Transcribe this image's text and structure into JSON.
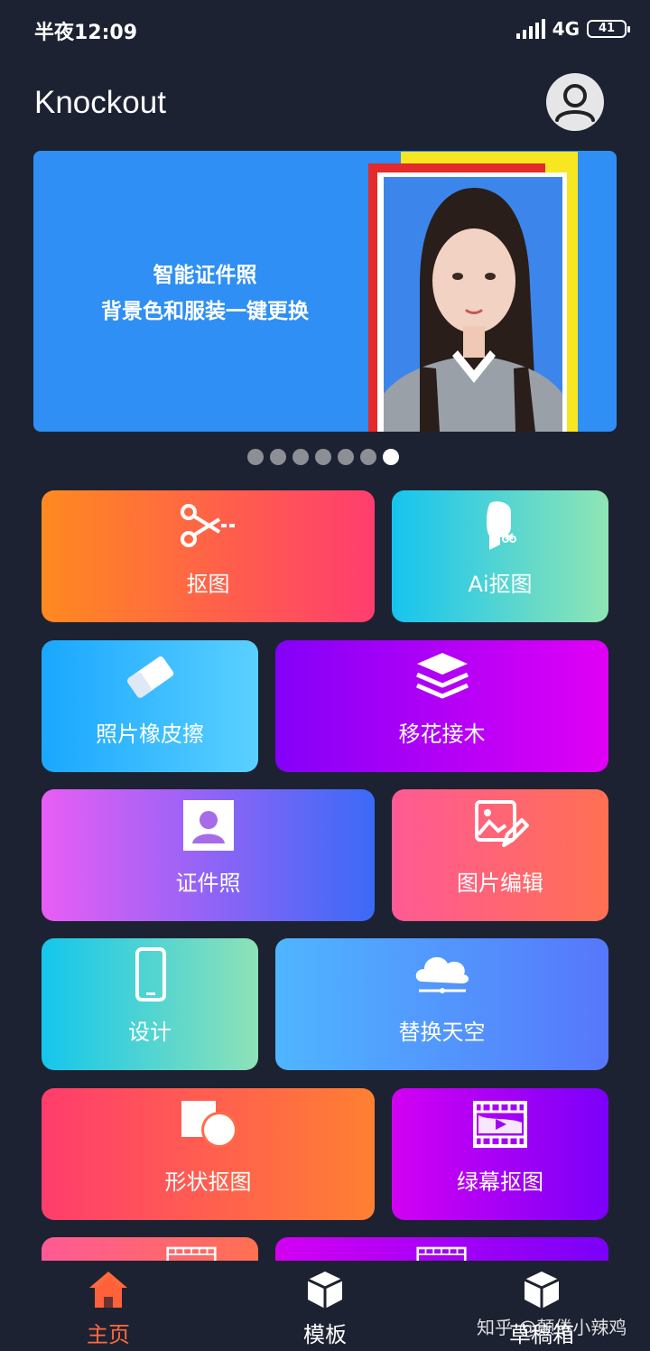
{
  "status_bar": {
    "time": "半夜12:09",
    "network": "4G",
    "battery": "41"
  },
  "header": {
    "title": "Knockout"
  },
  "banner": {
    "line1": "智能证件照",
    "line2": "背景色和服装一键更换",
    "active_dot": 7,
    "dot_count": 7
  },
  "tiles": [
    {
      "label": "抠图",
      "icon": "scissors-icon"
    },
    {
      "label": "Ai抠图",
      "icon": "ai-cutout-icon"
    },
    {
      "label": "照片橡皮擦",
      "icon": "eraser-icon"
    },
    {
      "label": "移花接木",
      "icon": "layers-icon"
    },
    {
      "label": "证件照",
      "icon": "id-photo-icon"
    },
    {
      "label": "图片编辑",
      "icon": "image-edit-icon"
    },
    {
      "label": "设计",
      "icon": "phone-icon"
    },
    {
      "label": "替换天空",
      "icon": "cloud-icon"
    },
    {
      "label": "形状抠图",
      "icon": "shape-icon"
    },
    {
      "label": "绿幕抠图",
      "icon": "film-icon"
    }
  ],
  "nav": {
    "home": "主页",
    "templates": "模板",
    "drafts": "草稿箱",
    "active_color": "#ff6a3d"
  },
  "watermark": "知乎 @颠倦小辣鸡"
}
